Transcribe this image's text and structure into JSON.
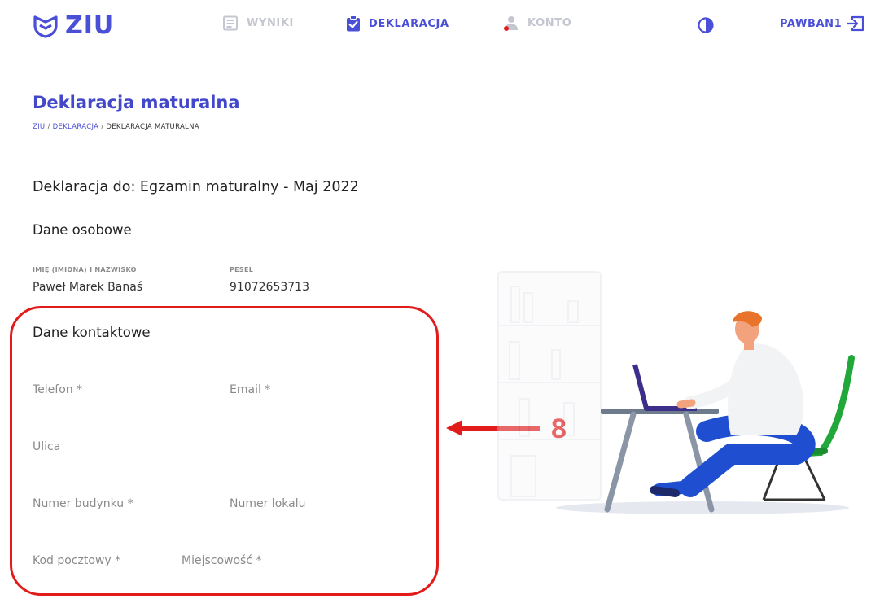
{
  "header": {
    "logo_text": "ZIU",
    "nav": [
      {
        "label": "WYNIKI",
        "icon": "results-icon",
        "active": false
      },
      {
        "label": "DEKLARACJA",
        "icon": "clipboard-check-icon",
        "active": true
      },
      {
        "label": "KONTO",
        "icon": "user-icon",
        "active": false
      }
    ],
    "user_label": "PAWBAN1",
    "accent_color": "#4a4fd8",
    "inactive_color": "#c4c6d0"
  },
  "page": {
    "title": "Deklaracja maturalna",
    "breadcrumb": [
      "ZIU",
      "DEKLARACJA",
      "DEKLARACJA MATURALNA"
    ],
    "declaration_heading": "Deklaracja do: Egzamin maturalny - Maj 2022"
  },
  "personal": {
    "heading": "Dane osobowe",
    "name_label": "IMIĘ (IMIONA) I NAZWISKO",
    "name_value": "Paweł Marek Banaś",
    "pesel_label": "PESEL",
    "pesel_value": "91072653713"
  },
  "contact": {
    "heading": "Dane kontaktowe",
    "fields": {
      "phone": "Telefon *",
      "email": "Email *",
      "street": "Ulica",
      "building": "Numer budynku *",
      "apartment": "Numer lokalu",
      "postal": "Kod pocztowy *",
      "city": "Miejscowość *"
    }
  },
  "annotation": {
    "number": "8",
    "color": "#e21b1b"
  }
}
